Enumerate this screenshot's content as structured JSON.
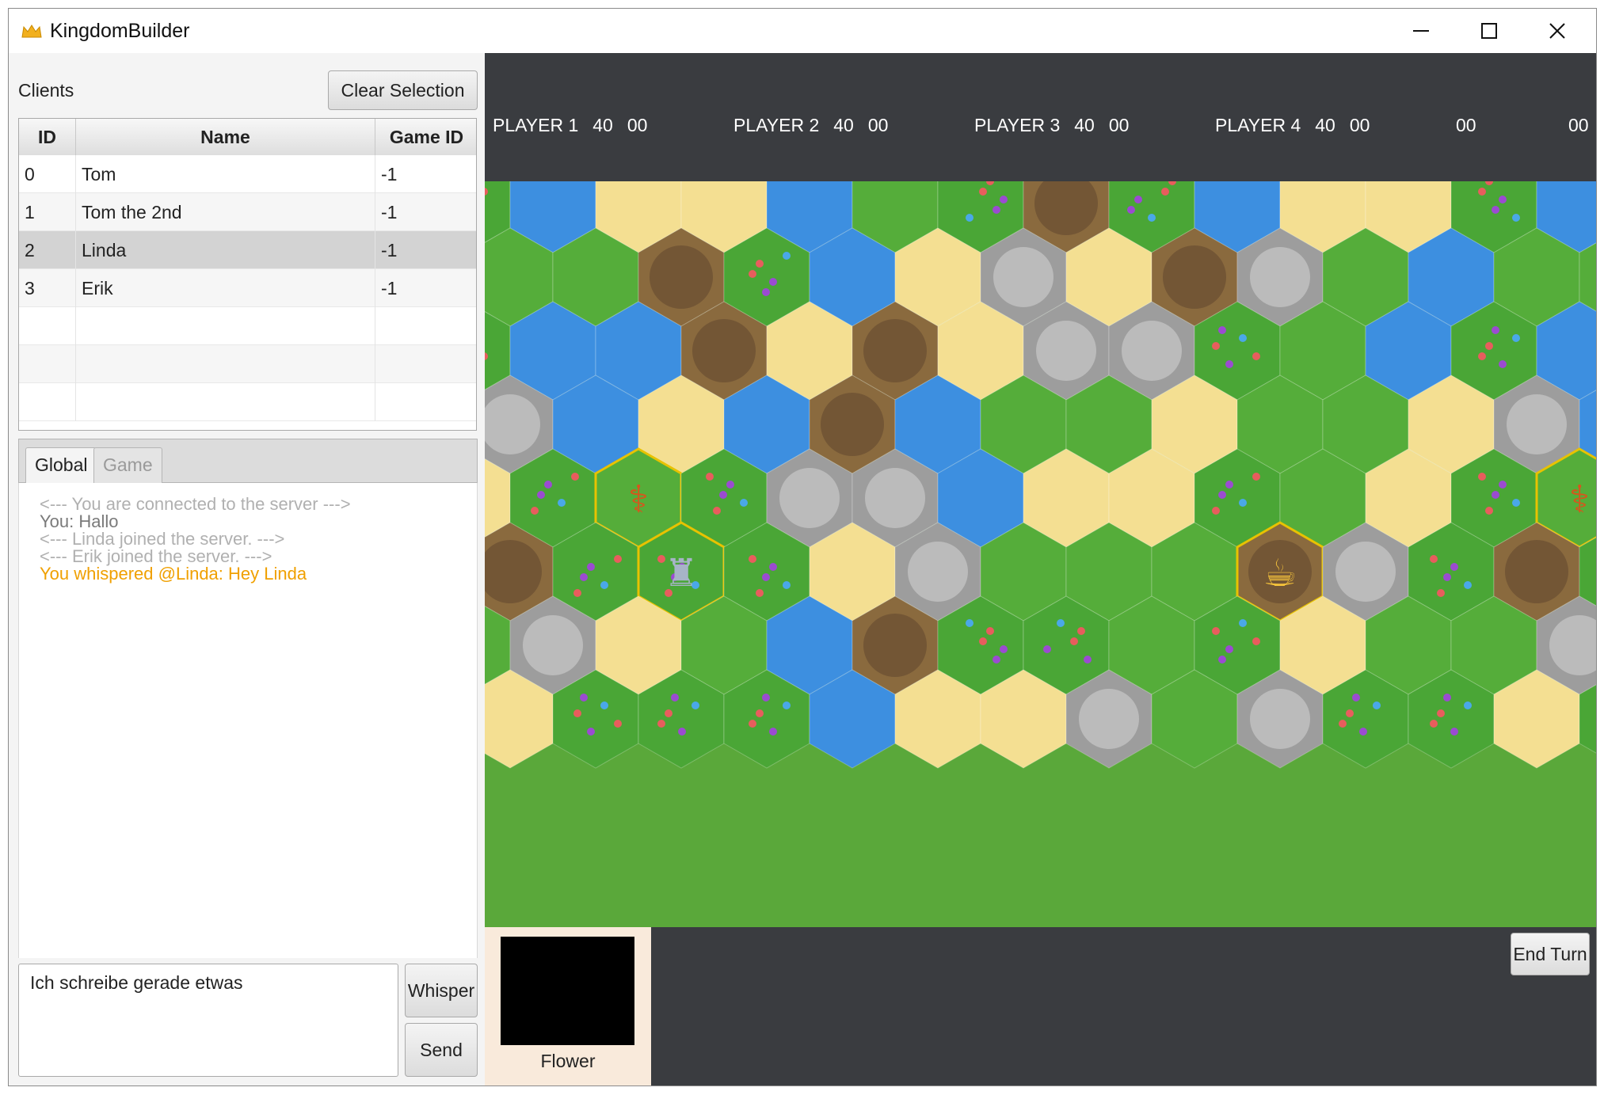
{
  "window": {
    "title": "KingdomBuilder",
    "minimize_icon": "minimize-icon",
    "maximize_icon": "maximize-icon",
    "close_icon": "close-icon"
  },
  "clients": {
    "label": "Clients",
    "clear_button": "Clear Selection",
    "columns": [
      "ID",
      "Name",
      "Game ID"
    ],
    "rows": [
      {
        "id": "0",
        "name": "Tom",
        "game_id": "-1",
        "selected": false
      },
      {
        "id": "1",
        "name": "Tom the 2nd",
        "game_id": "-1",
        "selected": false
      },
      {
        "id": "2",
        "name": "Linda",
        "game_id": "-1",
        "selected": true
      },
      {
        "id": "3",
        "name": "Erik",
        "game_id": "-1",
        "selected": false
      }
    ]
  },
  "chat": {
    "tabs": [
      {
        "label": "Global",
        "active": true
      },
      {
        "label": "Game",
        "active": false
      }
    ],
    "messages": [
      {
        "text": "<--- You are connected to the server --->",
        "color": "#b0b0b0"
      },
      {
        "text": "You: Hallo",
        "color": "#7a7a7a"
      },
      {
        "text": "<--- Linda joined the server. --->",
        "color": "#b0b0b0"
      },
      {
        "text": "<--- Erik joined the server. --->",
        "color": "#b0b0b0"
      },
      {
        "text": "You whispered @Linda: Hey Linda",
        "color": "#f0a000"
      }
    ],
    "input_value": "Ich schreibe gerade etwas",
    "whisper_button": "Whisper",
    "send_button": "Send"
  },
  "game": {
    "players": [
      {
        "name": "PLAYER 1",
        "settlements": "40",
        "score": "00"
      },
      {
        "name": "PLAYER 2",
        "settlements": "40",
        "score": "00"
      },
      {
        "name": "PLAYER 3",
        "settlements": "40",
        "score": "00"
      },
      {
        "name": "PLAYER 4",
        "settlements": "40",
        "score": "00"
      },
      {
        "name": "",
        "settlements": "",
        "score": "00"
      },
      {
        "name": "",
        "settlements": "",
        "score": "00"
      }
    ],
    "terrain_card_label": "Flower",
    "end_turn_button": "End Turn",
    "terrain_colors": {
      "grass": "#55ad3a",
      "flower": "#4aa636",
      "water": "#3d8fe0",
      "desert": "#f4df92",
      "canyon": "#8a6a3e",
      "mountain": "#9d9d9d",
      "forest": "#3f8a2a"
    },
    "special_tiles": [
      "scarecrow-tile",
      "castle-tile",
      "tavern-tile"
    ]
  }
}
